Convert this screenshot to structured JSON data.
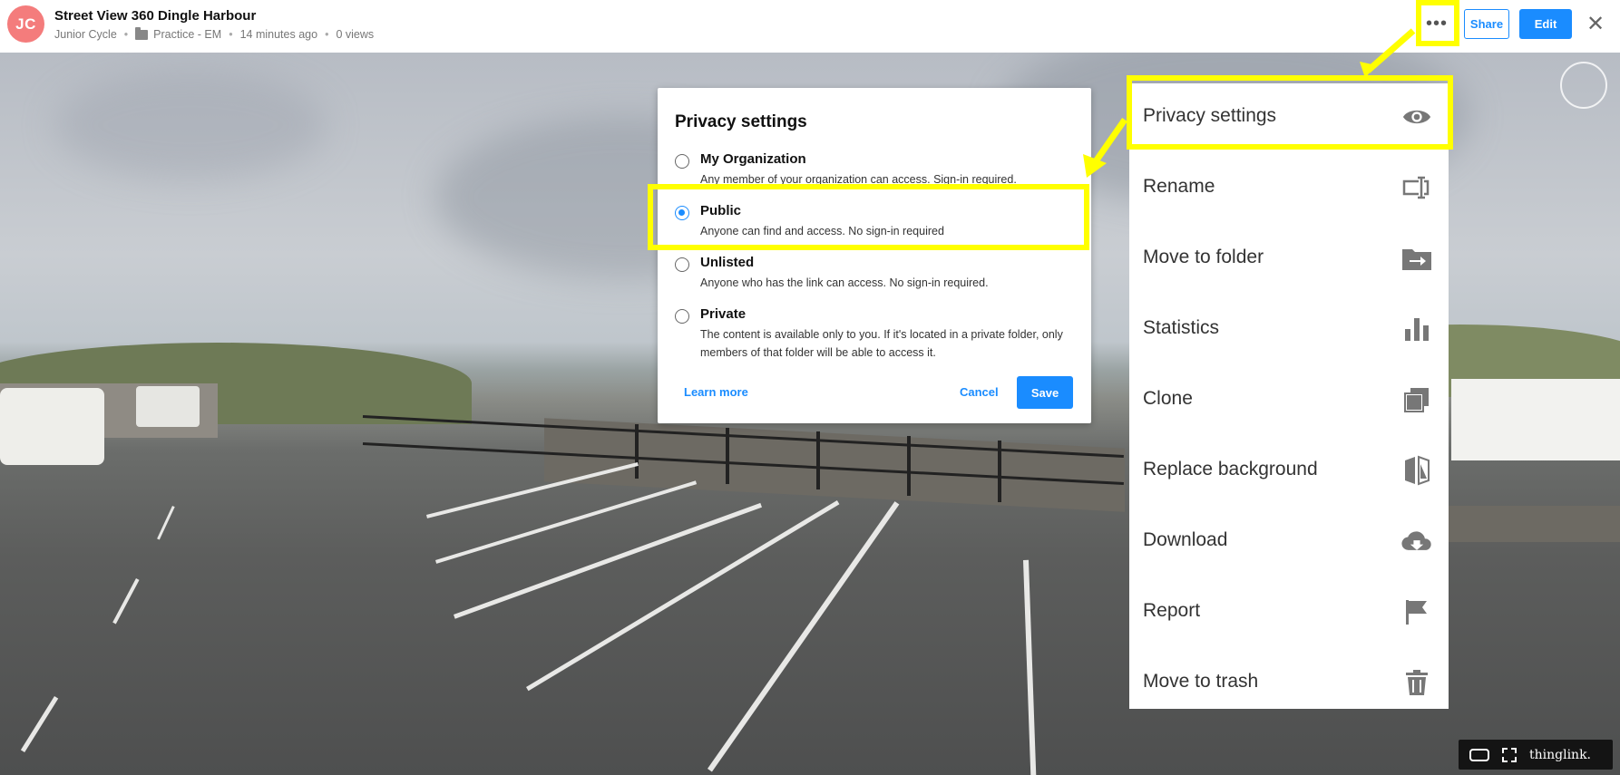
{
  "header": {
    "avatar_initials": "JC",
    "title": "Street View 360 Dingle Harbour",
    "author": "Junior Cycle",
    "folder": "Practice - EM",
    "time": "14 minutes ago",
    "views": "0 views",
    "more_label": "•••",
    "share_label": "Share",
    "edit_label": "Edit",
    "close_label": "✕"
  },
  "privacy": {
    "title": "Privacy settings",
    "options": [
      {
        "label": "My Organization",
        "desc": "Any member of your organization can access. Sign-in required.",
        "selected": false
      },
      {
        "label": "Public",
        "desc": "Anyone can find and access. No sign-in required",
        "selected": true
      },
      {
        "label": "Unlisted",
        "desc": "Anyone who has the link can access. No sign-in required.",
        "selected": false
      },
      {
        "label": "Private",
        "desc": "The content is available only to you. If it's located in a private folder, only members of that folder will be able to access it.",
        "selected": false
      }
    ],
    "learn_more": "Learn more",
    "cancel": "Cancel",
    "save": "Save"
  },
  "menu": {
    "items": [
      {
        "label": "Privacy settings",
        "icon": "eye-icon"
      },
      {
        "label": "Rename",
        "icon": "rename-icon"
      },
      {
        "label": "Move to folder",
        "icon": "move-folder-icon"
      },
      {
        "label": "Statistics",
        "icon": "bar-chart-icon"
      },
      {
        "label": "Clone",
        "icon": "clone-icon"
      },
      {
        "label": "Replace background",
        "icon": "replace-background-icon"
      },
      {
        "label": "Download",
        "icon": "cloud-download-icon"
      },
      {
        "label": "Report",
        "icon": "flag-icon"
      },
      {
        "label": "Move to trash",
        "icon": "trash-icon"
      }
    ]
  },
  "viewer": {
    "brand": "thinglink."
  },
  "colors": {
    "accent": "#1a8cff",
    "highlight": "#ffff00",
    "avatar": "#f47c7c"
  }
}
